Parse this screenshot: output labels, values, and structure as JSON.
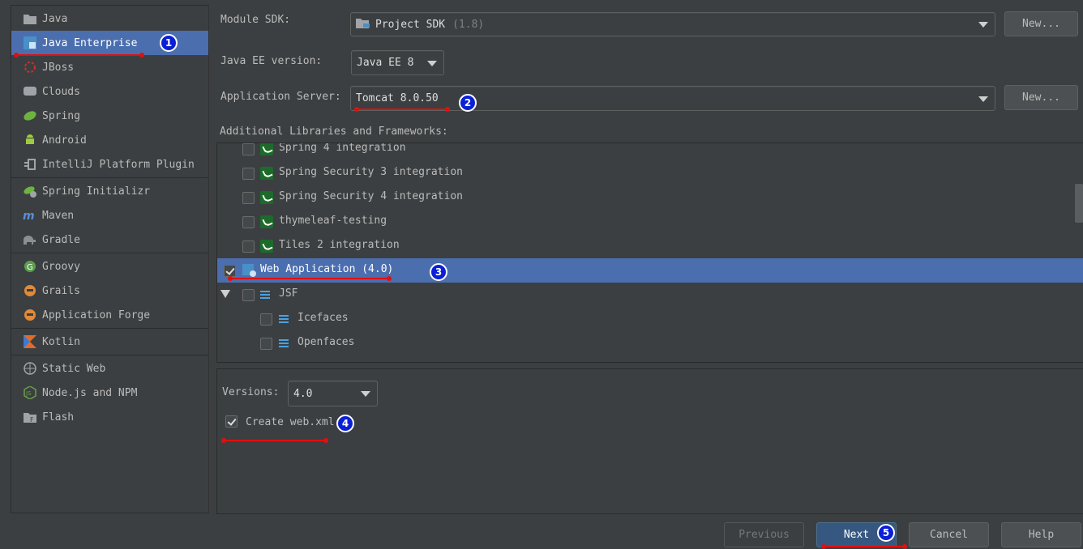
{
  "sidebar": {
    "items": [
      {
        "label": "Java",
        "icon": "folder-icon"
      },
      {
        "label": "Java Enterprise",
        "icon": "java-enterprise-icon"
      },
      {
        "label": "JBoss",
        "icon": "jboss-icon"
      },
      {
        "label": "Clouds",
        "icon": "cloud-icon"
      },
      {
        "label": "Spring",
        "icon": "spring-leaf-icon"
      },
      {
        "label": "Android",
        "icon": "android-icon"
      },
      {
        "label": "IntelliJ Platform Plugin",
        "icon": "plugin-icon"
      },
      {
        "label": "Spring Initializr",
        "icon": "spring-initializr-icon"
      },
      {
        "label": "Maven",
        "icon": "maven-icon"
      },
      {
        "label": "Gradle",
        "icon": "gradle-elephant-icon"
      },
      {
        "label": "Groovy",
        "icon": "groovy-icon"
      },
      {
        "label": "Grails",
        "icon": "grails-icon"
      },
      {
        "label": "Application Forge",
        "icon": "forge-icon"
      },
      {
        "label": "Kotlin",
        "icon": "kotlin-icon"
      },
      {
        "label": "Static Web",
        "icon": "globe-icon"
      },
      {
        "label": "Node.js and NPM",
        "icon": "nodejs-icon"
      },
      {
        "label": "Flash",
        "icon": "flash-folder-icon"
      }
    ]
  },
  "form": {
    "module_sdk_label": "Module SDK:",
    "module_sdk_value": "Project SDK",
    "module_sdk_version": "(1.8)",
    "new_button_label": "New...",
    "javaee_label": "Java EE version:",
    "javaee_value": "Java EE 8",
    "app_server_label": "Application Server:",
    "app_server_value": "Tomcat 8.0.50",
    "libs_label": "Additional Libraries and Frameworks:"
  },
  "frameworks": [
    {
      "label": "Spring 4 integration",
      "checked": false
    },
    {
      "label": "Spring Security 3 integration",
      "checked": false
    },
    {
      "label": "Spring Security 4 integration",
      "checked": false
    },
    {
      "label": "thymeleaf-testing",
      "checked": false
    },
    {
      "label": "Tiles 2 integration",
      "checked": false
    },
    {
      "label": "Web Application (4.0)",
      "checked": true
    },
    {
      "label": "JSF",
      "checked": false
    },
    {
      "label": "Icefaces",
      "checked": false
    },
    {
      "label": "Openfaces",
      "checked": false
    }
  ],
  "options": {
    "versions_label": "Versions:",
    "versions_value": "4.0",
    "create_webxml_label": "Create web.xml",
    "create_webxml_checked": true
  },
  "buttons": {
    "previous": "Previous",
    "next": "Next",
    "cancel": "Cancel",
    "help": "Help"
  },
  "annotations": [
    "1",
    "2",
    "3",
    "4",
    "5"
  ],
  "colors": {
    "background": "#3c3f41",
    "selection": "#4b6eaf",
    "default_button": "#365880",
    "annotation_line": "#e01010",
    "annotation_badge": "#0a1fd6"
  }
}
